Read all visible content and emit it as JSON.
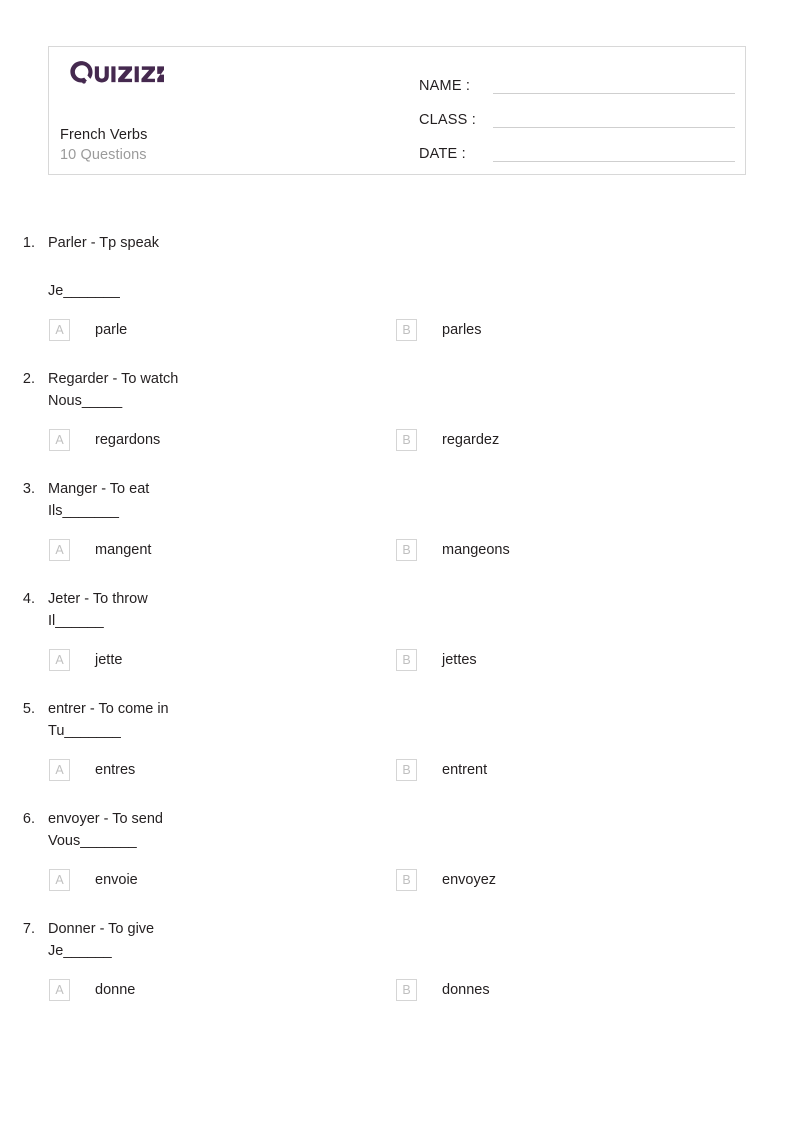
{
  "header": {
    "logo_text": "Quizizz",
    "logo_color": "#45294f",
    "quiz_title": "French Verbs",
    "quiz_subtitle": "10 Questions",
    "fields": [
      {
        "label": "NAME :"
      },
      {
        "label": "CLASS :"
      },
      {
        "label": "DATE  :"
      }
    ]
  },
  "questions": [
    {
      "number": "1.",
      "prompt": "Parler - Tp speak",
      "fill": "Je_______",
      "fill_spaced": true,
      "options": [
        {
          "letter": "A",
          "text": "parle"
        },
        {
          "letter": "B",
          "text": "parles"
        }
      ]
    },
    {
      "number": "2.",
      "prompt": "Regarder - To watch",
      "fill": "Nous_____",
      "fill_spaced": false,
      "options": [
        {
          "letter": "A",
          "text": "regardons"
        },
        {
          "letter": "B",
          "text": "regardez"
        }
      ]
    },
    {
      "number": "3.",
      "prompt": "Manger - To eat",
      "fill": "Ils_______",
      "fill_spaced": false,
      "options": [
        {
          "letter": "A",
          "text": "mangent"
        },
        {
          "letter": "B",
          "text": "mangeons"
        }
      ]
    },
    {
      "number": "4.",
      "prompt": "Jeter - To throw",
      "fill": "Il______",
      "fill_spaced": false,
      "options": [
        {
          "letter": "A",
          "text": "jette"
        },
        {
          "letter": "B",
          "text": "jettes"
        }
      ]
    },
    {
      "number": "5.",
      "prompt": "entrer - To come in",
      "fill": "Tu_______",
      "fill_spaced": false,
      "options": [
        {
          "letter": "A",
          "text": "entres"
        },
        {
          "letter": "B",
          "text": "entrent"
        }
      ]
    },
    {
      "number": "6.",
      "prompt": "envoyer - To send",
      "fill": "Vous_______",
      "fill_spaced": false,
      "options": [
        {
          "letter": "A",
          "text": "envoie"
        },
        {
          "letter": "B",
          "text": "envoyez"
        }
      ]
    },
    {
      "number": "7.",
      "prompt": "Donner - To give",
      "fill": "Je______",
      "fill_spaced": false,
      "options": [
        {
          "letter": "A",
          "text": "donne"
        },
        {
          "letter": "B",
          "text": "donnes"
        }
      ]
    }
  ]
}
